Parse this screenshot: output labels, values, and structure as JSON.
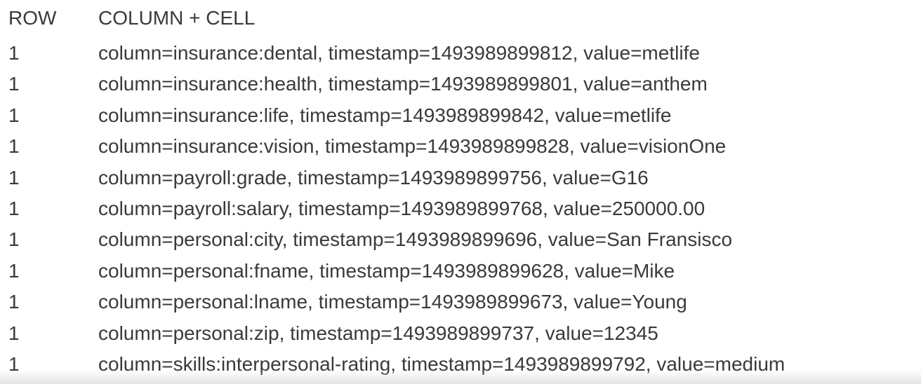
{
  "header": {
    "row_label": "ROW",
    "cell_label": "COLUMN + CELL"
  },
  "rows": [
    {
      "row": "1",
      "cell": "column=insurance:dental, timestamp=1493989899812, value=metlife"
    },
    {
      "row": "1",
      "cell": "column=insurance:health, timestamp=1493989899801, value=anthem"
    },
    {
      "row": "1",
      "cell": "column=insurance:life, timestamp=1493989899842, value=metlife"
    },
    {
      "row": "1",
      "cell": "column=insurance:vision, timestamp=1493989899828, value=visionOne"
    },
    {
      "row": "1",
      "cell": "column=payroll:grade, timestamp=1493989899756, value=G16"
    },
    {
      "row": "1",
      "cell": "column=payroll:salary, timestamp=1493989899768, value=250000.00"
    },
    {
      "row": "1",
      "cell": "column=personal:city, timestamp=1493989899696, value=San Fransisco"
    },
    {
      "row": "1",
      "cell": "column=personal:fname, timestamp=1493989899628, value=Mike"
    },
    {
      "row": "1",
      "cell": "column=personal:lname, timestamp=1493989899673, value=Young"
    },
    {
      "row": "1",
      "cell": "column=personal:zip, timestamp=1493989899737, value=12345"
    },
    {
      "row": "1",
      "cell": "column=skills:interpersonal-rating, timestamp=1493989899792, value=medium"
    }
  ]
}
